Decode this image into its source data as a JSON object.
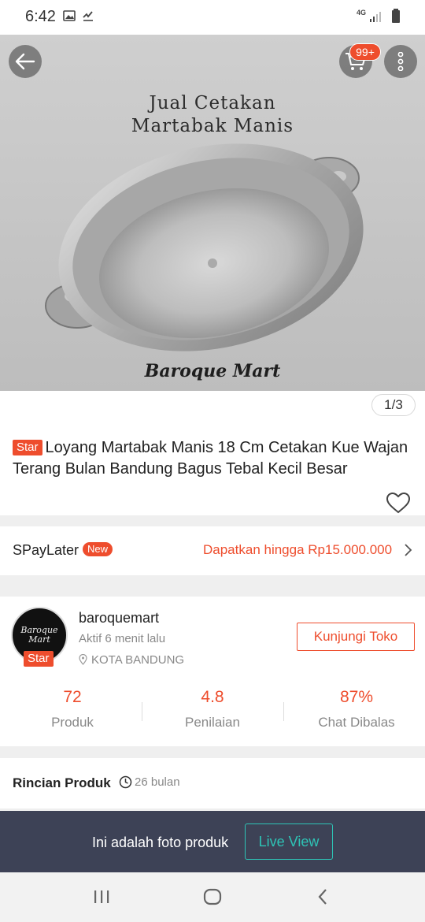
{
  "status_bar": {
    "time": "6:42",
    "network": "4G"
  },
  "hero": {
    "caption_line1": "Jual Cetakan",
    "caption_line2": "Martabak Manis",
    "watermark": "Baroque Mart",
    "cart_badge": "99+",
    "image_counter": "1/3"
  },
  "product": {
    "star_tag": "Star",
    "title": "Loyang Martabak Manis 18 Cm Cetakan Kue Wajan Terang Bulan Bandung Bagus Tebal Kecil Besar"
  },
  "spaylater": {
    "label": "SPayLater",
    "badge": "New",
    "offer": "Dapatkan hingga Rp15.000.000"
  },
  "shop": {
    "avatar_text_line1": "Baroque",
    "avatar_text_line2": "Mart",
    "star_tag": "Star",
    "name": "baroquemart",
    "active": "Aktif 6 menit lalu",
    "location": "KOTA BANDUNG",
    "visit_button": "Kunjungi Toko",
    "stats": [
      {
        "value": "72",
        "label": "Produk"
      },
      {
        "value": "4.8",
        "label": "Penilaian"
      },
      {
        "value": "87%",
        "label": "Chat Dibalas"
      }
    ]
  },
  "details": {
    "title": "Rincian Produk",
    "age": "26 bulan"
  },
  "banner": {
    "text": "Ini adalah foto produk",
    "button": "Live View"
  },
  "colors": {
    "accent": "#ee4d2d",
    "banner_bg": "#3d4256",
    "live_teal": "#2ec4b6"
  }
}
